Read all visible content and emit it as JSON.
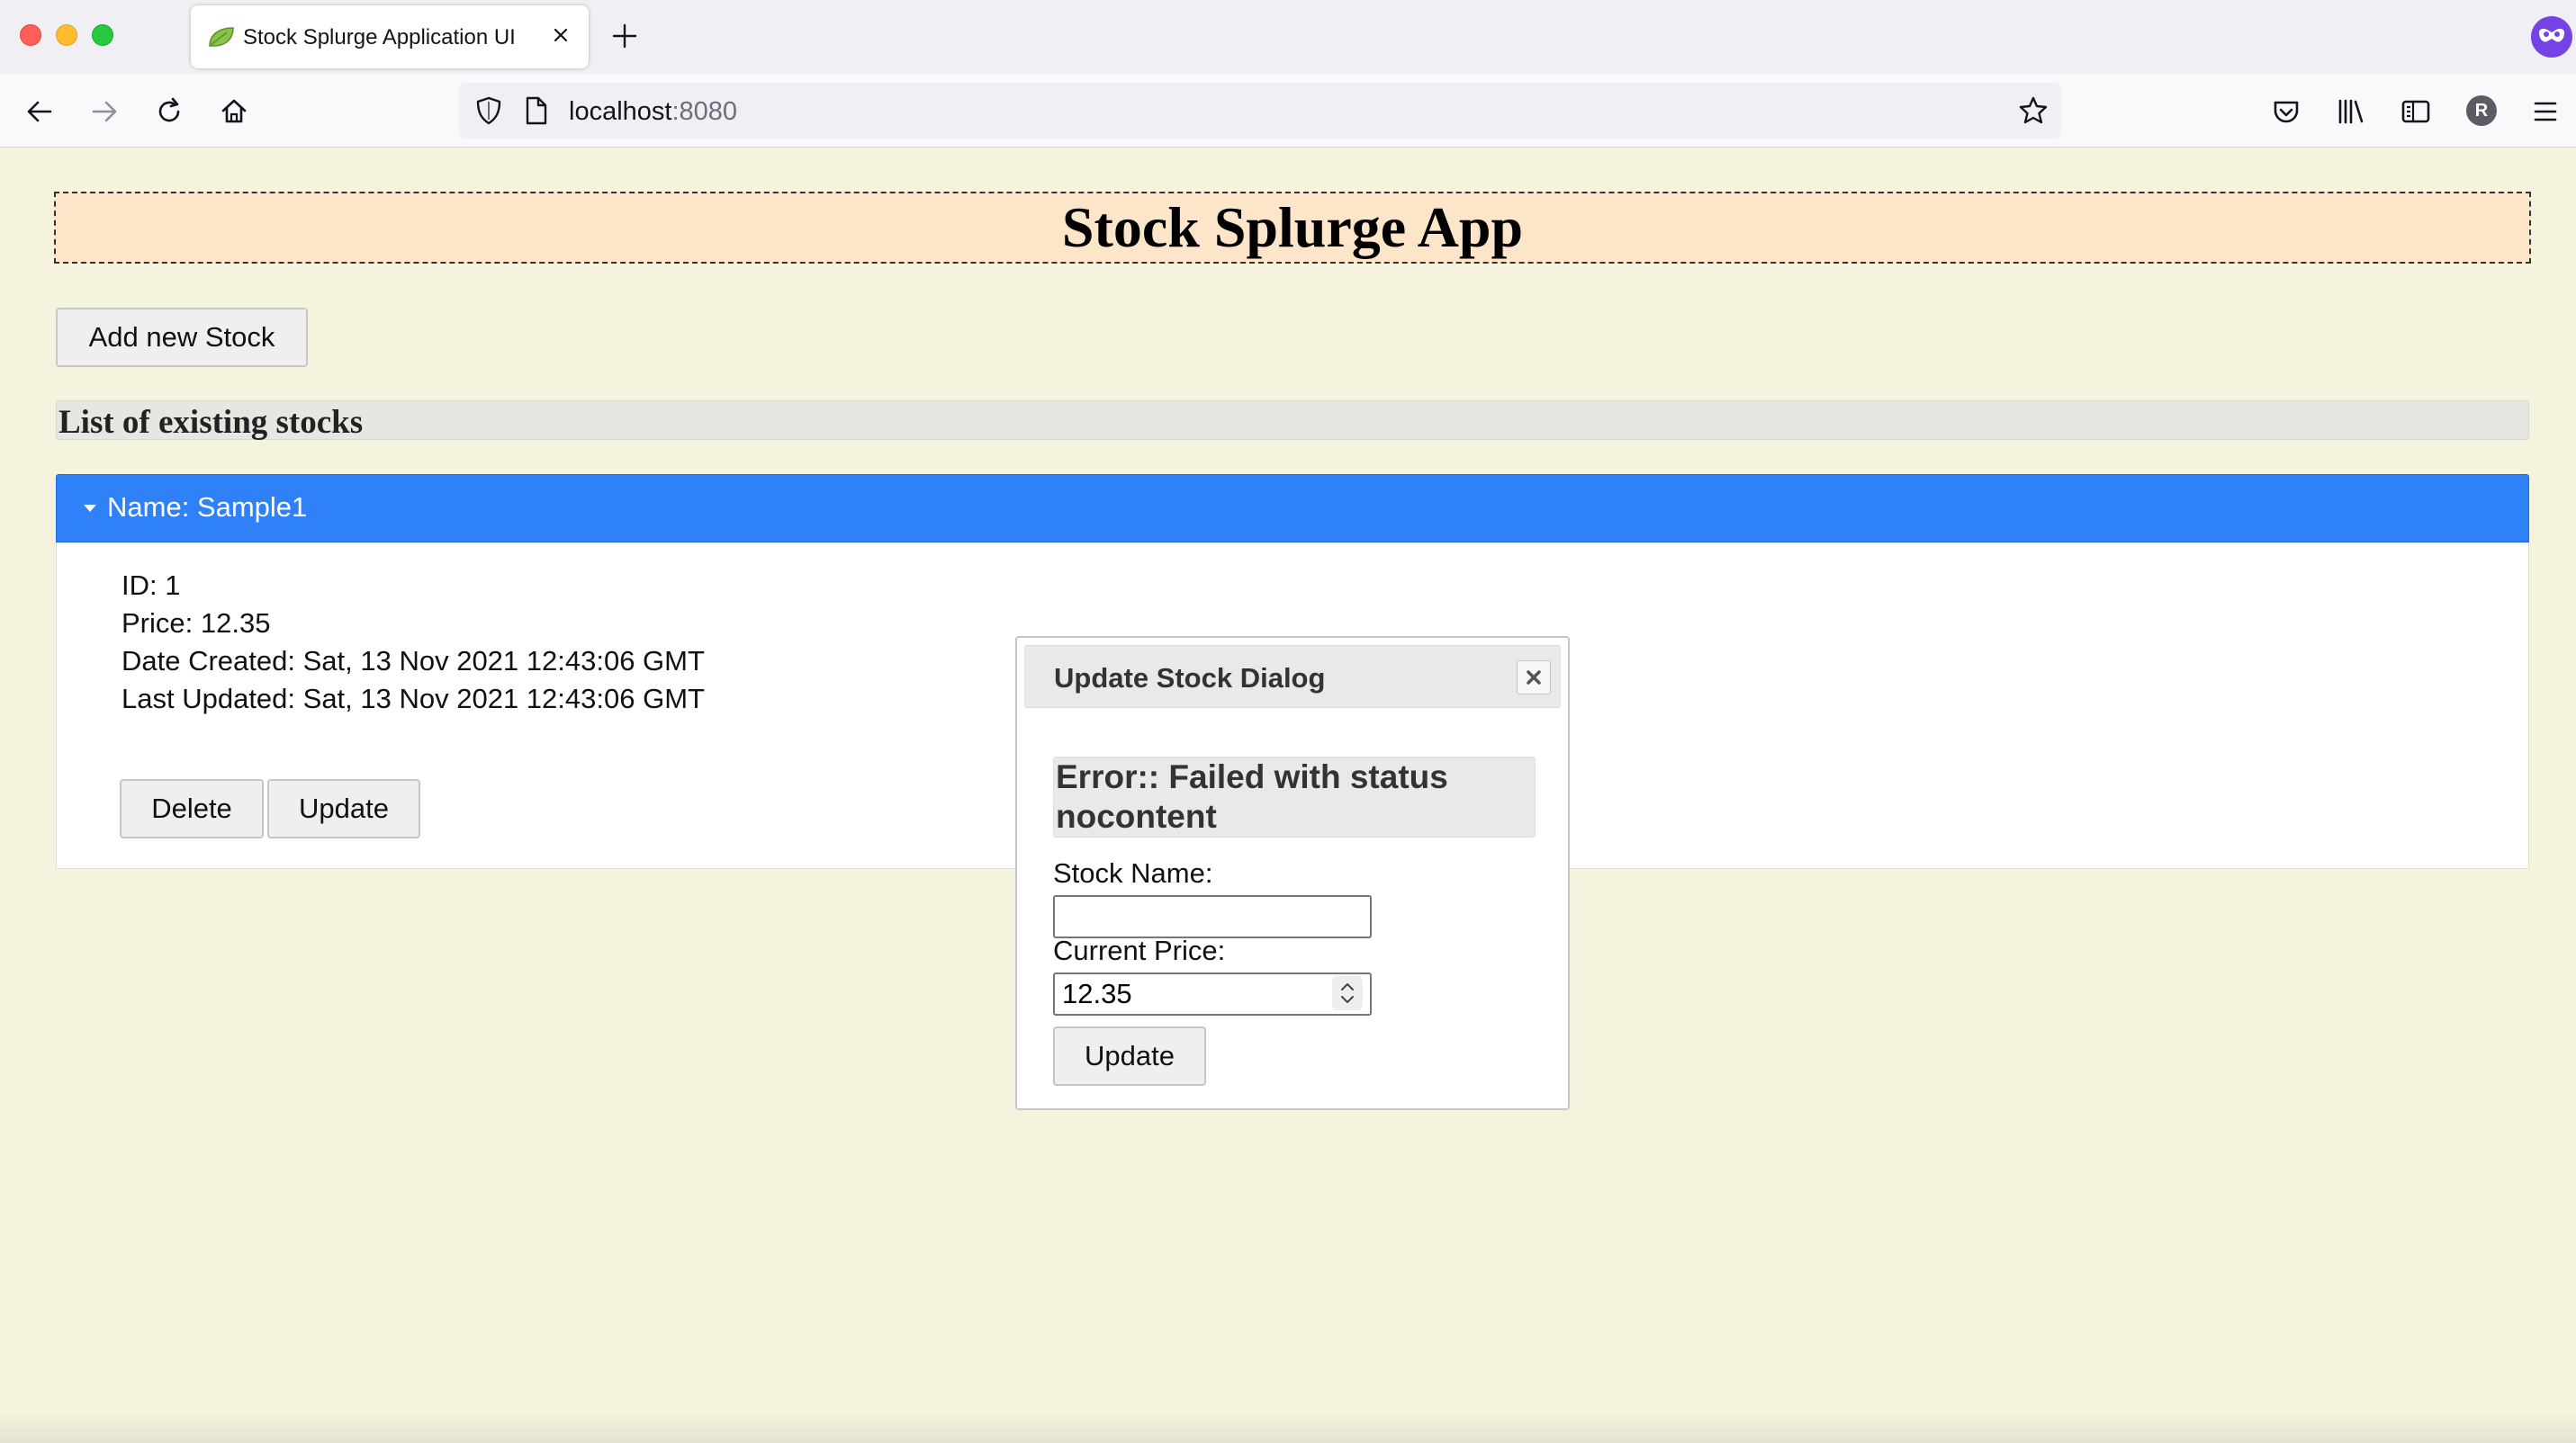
{
  "browser": {
    "tab_title": "Stock Splurge Application UI",
    "url_host": "localhost",
    "url_port": ":8080",
    "profile_initial": "R"
  },
  "app": {
    "title": "Stock Splurge App",
    "add_button": "Add new Stock",
    "list_heading": "List of existing stocks",
    "stock": {
      "header": "Name: Sample1",
      "id_line": "ID: 1",
      "price_line": "Price: 12.35",
      "created_line": "Date Created: Sat, 13 Nov 2021 12:43:06 GMT",
      "updated_line": "Last Updated: Sat, 13 Nov 2021 12:43:06 GMT",
      "delete_button": "Delete",
      "update_button": "Update"
    }
  },
  "dialog": {
    "title": "Update Stock Dialog",
    "error": "Error:: Failed with status nocontent",
    "name_label": "Stock Name:",
    "name_value": "",
    "price_label": "Current Price:",
    "price_value": "12.35",
    "submit_button": "Update"
  },
  "colors": {
    "page_background": "#f5f3dd",
    "header_background": "#fce5c8",
    "accordion_active": "#2f81f7"
  },
  "icons": [
    "back-icon",
    "forward-icon",
    "reload-icon",
    "home-icon",
    "shield-icon",
    "page-icon",
    "star-icon",
    "pocket-icon",
    "library-icon",
    "sidebar-icon",
    "menu-icon",
    "close-icon",
    "plus-icon",
    "mask-icon"
  ]
}
